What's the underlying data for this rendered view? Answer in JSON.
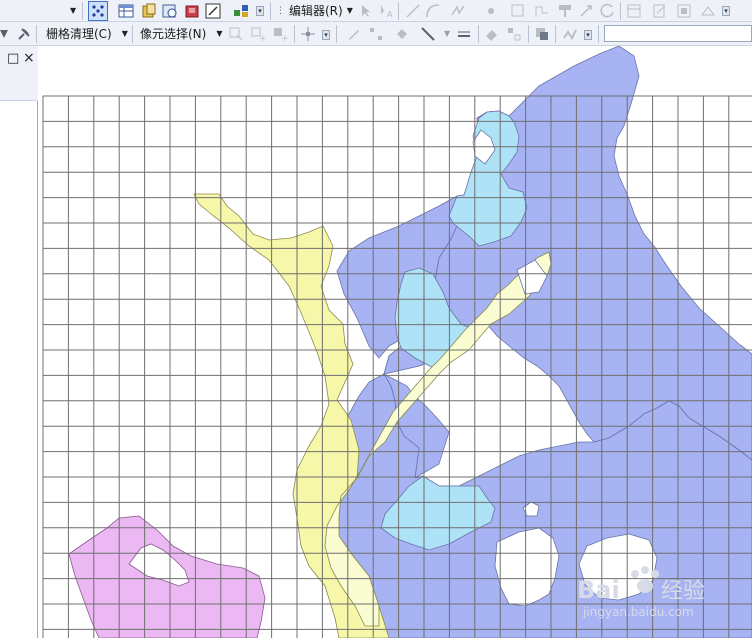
{
  "toolbar": {
    "editor_menu_label": "编辑器(R)",
    "raster_cleanup_label": "栅格清理(C)",
    "cell_selection_label": "像元选择(N)"
  },
  "toc_panel": {
    "pin_glyph": "□",
    "close_glyph": "×"
  },
  "watermark": {
    "brand_text": "Bai",
    "brand_text_2": "经验",
    "url_text": "jingyan.baidu.com"
  },
  "colors": {
    "toolbar_bg": "#eef2f8",
    "grid_line": "#6f6f6f",
    "polygon_blue": "#a7b3f3",
    "polygon_cyan": "#aee2f7",
    "polygon_yellow": "#f6f7a8",
    "polygon_pale_yellow": "#fafcd2",
    "polygon_pink": "#ecb8f3"
  }
}
